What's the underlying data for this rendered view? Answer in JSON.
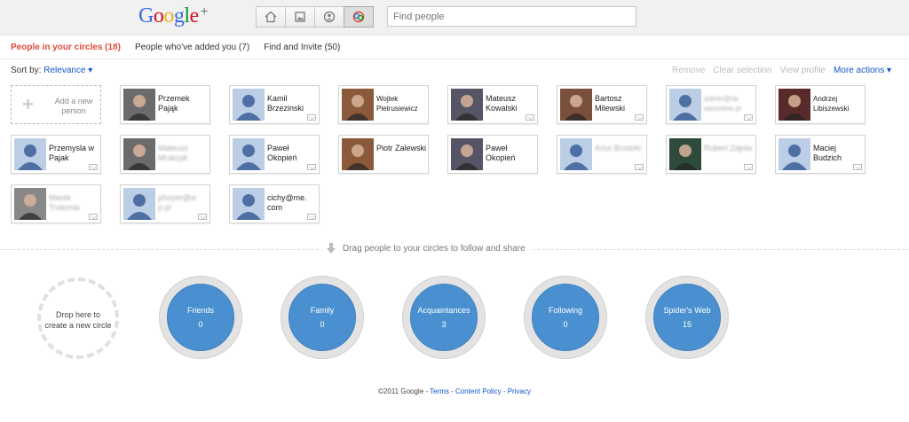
{
  "header": {
    "logo_text": "Google",
    "logo_plus": "+",
    "logo_colors": [
      "#3369e8",
      "#d50f25",
      "#eeb211",
      "#3369e8",
      "#009925",
      "#d50f25"
    ],
    "nav": [
      {
        "icon": "home-icon"
      },
      {
        "icon": "photos-icon"
      },
      {
        "icon": "profile-icon"
      },
      {
        "icon": "circles-icon",
        "active": true
      }
    ],
    "search_placeholder": "Find people"
  },
  "tabs": [
    {
      "label": "People in your circles (18)",
      "active": true
    },
    {
      "label": "People who've added you (7)"
    },
    {
      "label": "Find and Invite (50)"
    }
  ],
  "sort": {
    "label": "Sort by:",
    "value": "Relevance ▾"
  },
  "actions": {
    "remove": "Remove",
    "clear": "Clear selection",
    "view": "View profile",
    "more": "More actions ▾"
  },
  "add_person": "Add a new person",
  "people": [
    {
      "name": "Przemek Pająk",
      "photo": true
    },
    {
      "name": "Kamil Brzezinski",
      "photo": false
    },
    {
      "name": "Wojtek Pietrusiewicz",
      "photo": true
    },
    {
      "name": "Mateusz Kowalski",
      "photo": true
    },
    {
      "name": "Bartosz Milewski",
      "photo": true
    },
    {
      "name": "admin@ne wsvorline.pl",
      "photo": false,
      "blur": true
    },
    {
      "name": "Andrzej Libiszewski",
      "photo": true
    },
    {
      "name": "Przemysla w Pajak",
      "photo": false
    },
    {
      "name": "Mateusz Mrakzyk",
      "photo": true,
      "blur": true
    },
    {
      "name": "Paweł Okopień",
      "photo": false
    },
    {
      "name": "Piotr Zalewski",
      "photo": true
    },
    {
      "name": "Paweł Okopień",
      "photo": true
    },
    {
      "name": "Artur Brodzki",
      "photo": false,
      "blur": true
    },
    {
      "name": "Robert Zajola",
      "photo": true,
      "blur": true
    },
    {
      "name": "Maciej Budzich",
      "photo": false
    },
    {
      "name": "Marek Trokonia",
      "photo": true,
      "blur": true
    },
    {
      "name": "phoyer@w p.pl",
      "photo": false,
      "blur": true
    },
    {
      "name": "cichy@me. com",
      "photo": false
    }
  ],
  "drag_message": "Drag people to your circles to follow and share",
  "new_circle": "Drop here to create a new circle",
  "circles": [
    {
      "name": "Friends",
      "count": "0"
    },
    {
      "name": "Family",
      "count": "0"
    },
    {
      "name": "Acquaintances",
      "count": "3"
    },
    {
      "name": "Following",
      "count": "0"
    },
    {
      "name": "Spider's Web",
      "count": "15"
    }
  ],
  "footer": {
    "copyright": "©2011 Google - ",
    "terms": "Terms",
    "sep": " - ",
    "policy": "Content Policy",
    "privacy": "Privacy"
  }
}
